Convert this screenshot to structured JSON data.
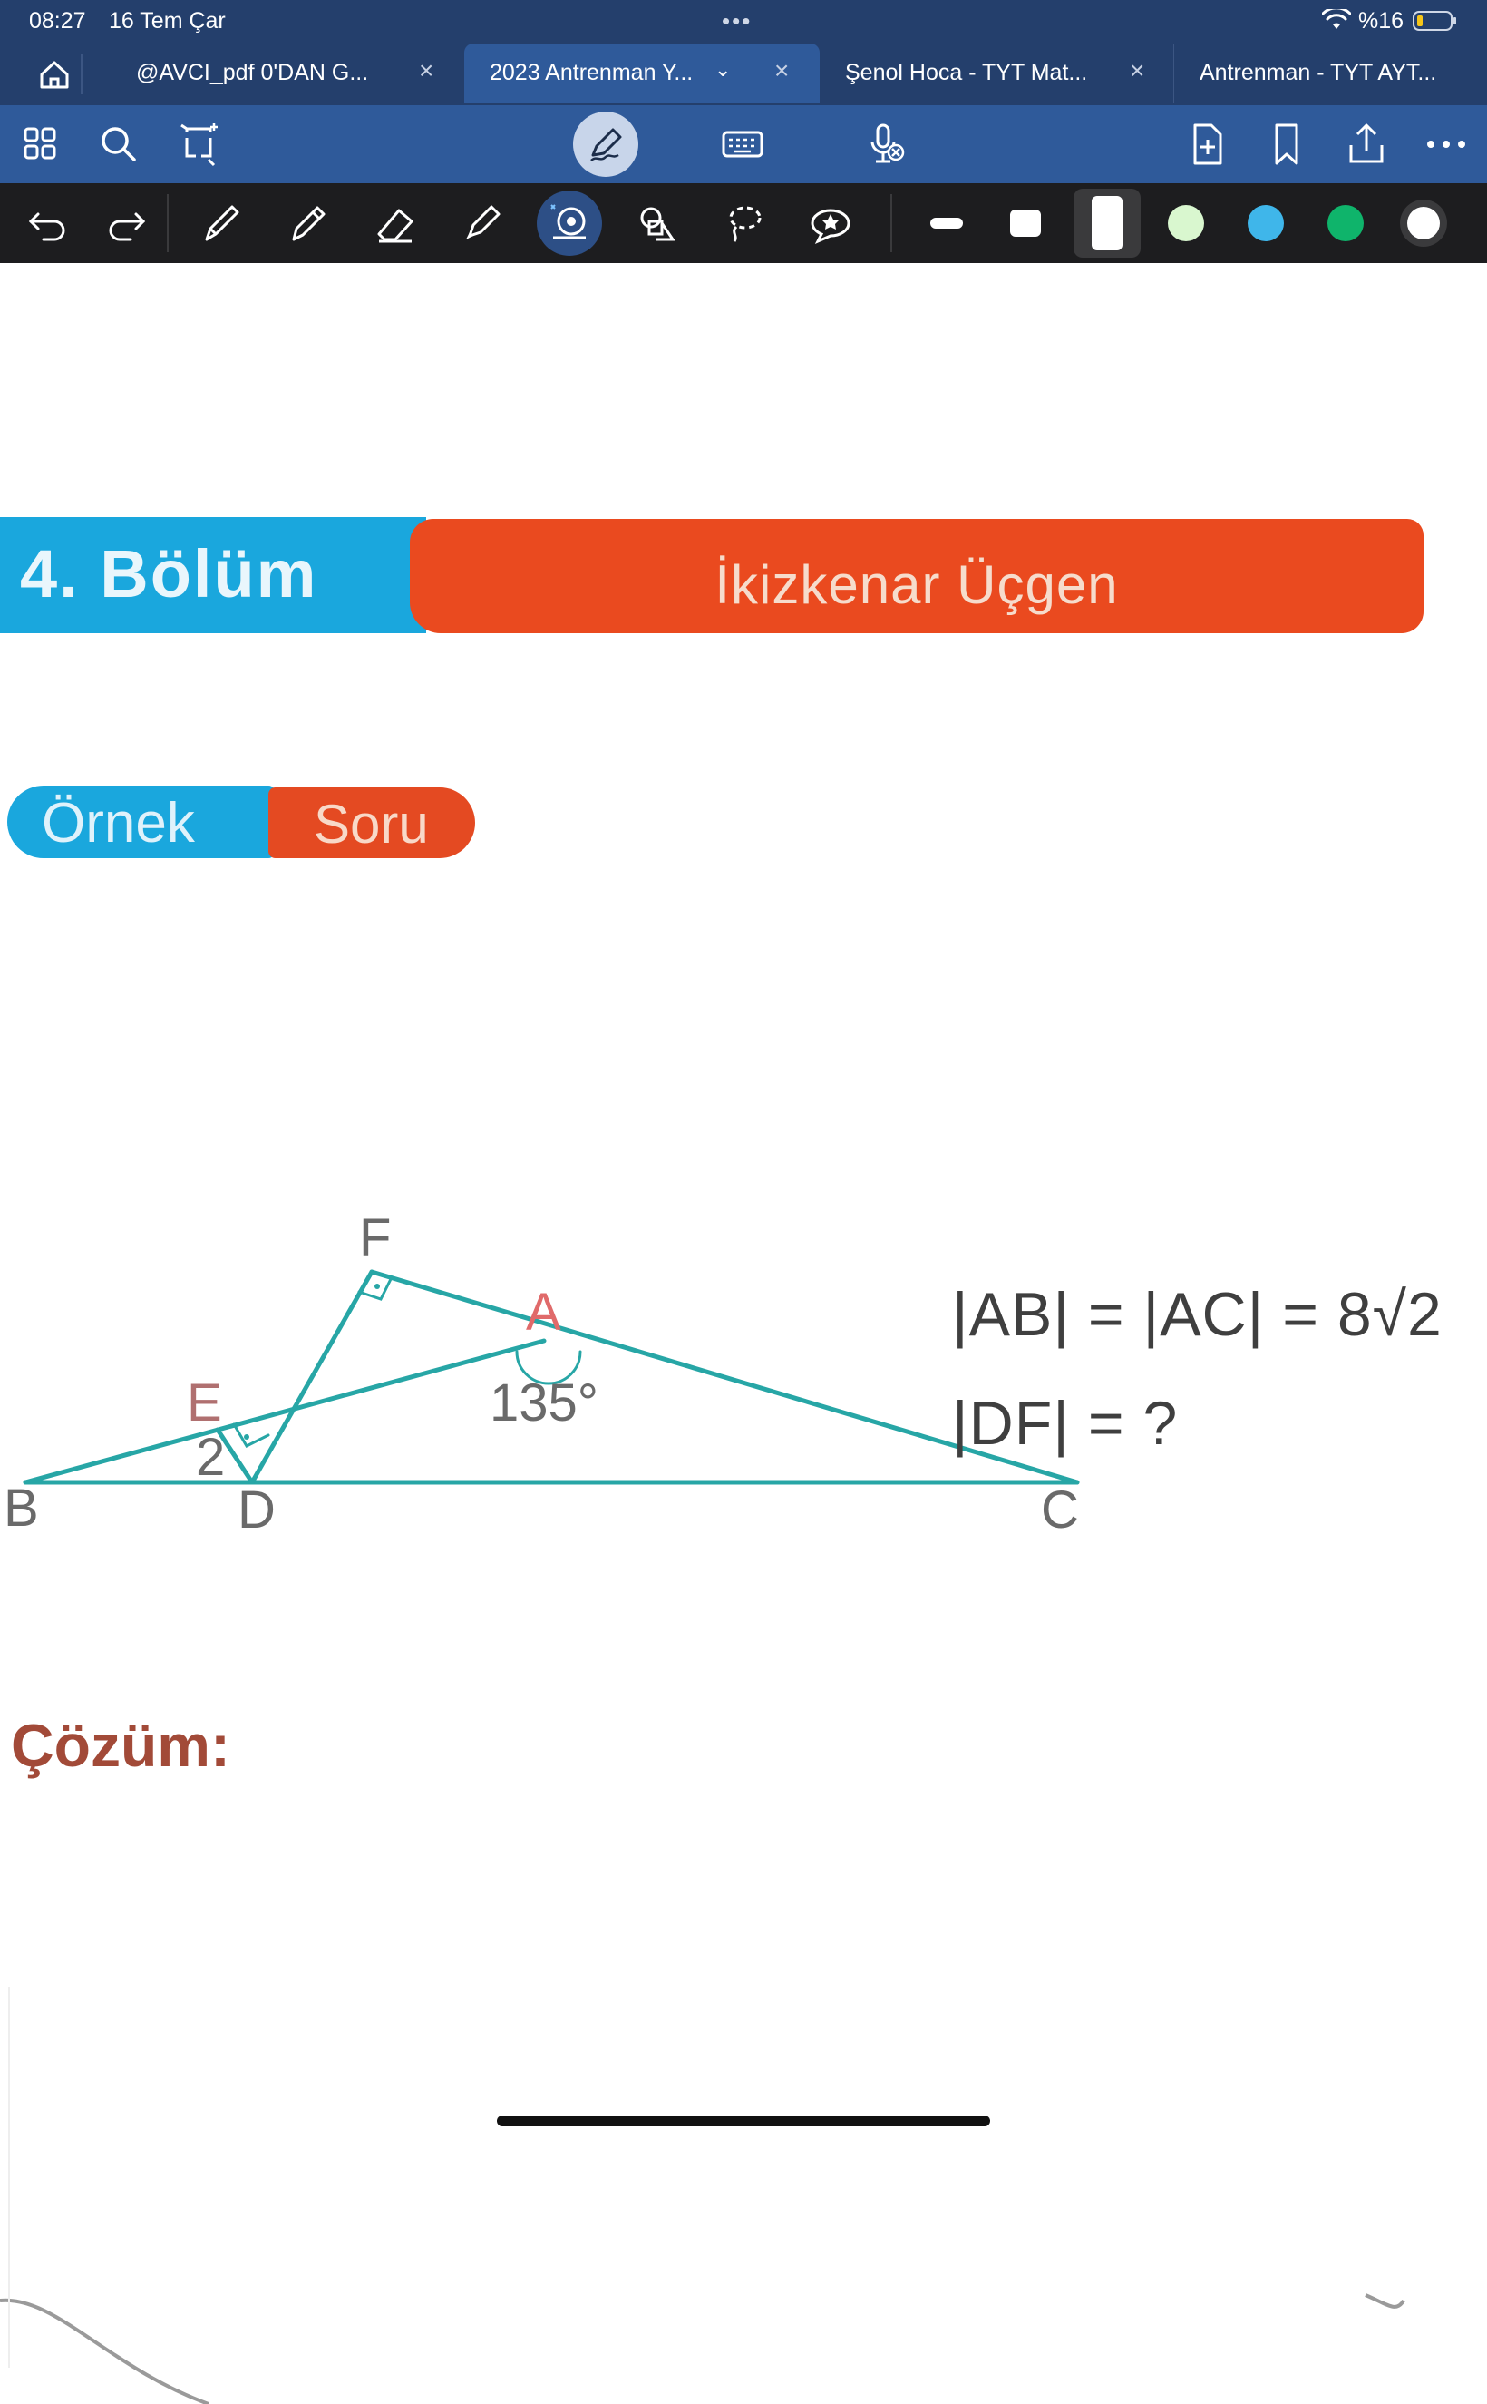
{
  "status_bar": {
    "time": "08:27",
    "date": "16 Tem Çar",
    "dots": "•••",
    "battery": "%16"
  },
  "tabs": [
    {
      "label": "@AVCI_pdf 0'DAN G...",
      "close": "×"
    },
    {
      "label": "2023 Antrenman Y...",
      "chevron": "⌄",
      "close": "×"
    },
    {
      "label": "Şenol Hoca - TYT Mat...",
      "close": "×"
    },
    {
      "label": "Antrenman - TYT AYT..."
    }
  ],
  "icons": {
    "home": "home-icon",
    "grid": "grid-icon",
    "search": "search-icon",
    "crop": "crop-icon",
    "pen_mode": "pen-mode-icon",
    "keyboard": "keyboard-icon",
    "mic": "mic-icon",
    "add_page": "add-page-icon",
    "bookmark": "bookmark-icon",
    "share": "share-icon",
    "more": "more-icon"
  },
  "colors": {
    "status_bg": "#243f6c",
    "nav_bg": "#2f5a9a",
    "toolbar_bg": "#1d1d1f",
    "palette": [
      "#d9f7cf",
      "#3fb6ea",
      "#0fb46b",
      "#ffffff"
    ],
    "banner_blue": "#1aa7dd",
    "banner_red": "#ea4a1f",
    "figure_line": "#27a6a6"
  },
  "document": {
    "section": "4. Bölüm",
    "topic": "İkizkenar Üçgen",
    "tag_left": "Örnek",
    "tag_right": "Soru",
    "given_1": "|AB| = |AC| = 8√2",
    "given_2": "|DF| = ?",
    "solution_label": "Çözüm:",
    "figure": {
      "labels": {
        "F": "F",
        "A": "A",
        "E": "E",
        "B": "B",
        "D": "D",
        "C": "C"
      },
      "angle": "135°",
      "length": "2"
    }
  }
}
